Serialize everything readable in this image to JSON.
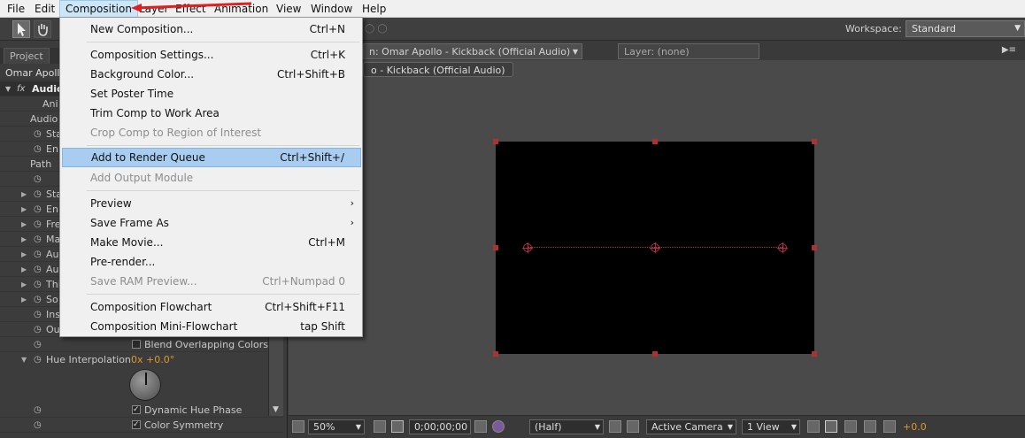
{
  "menubar": {
    "items": [
      "File",
      "Edit",
      "Composition",
      "Layer",
      "Effect",
      "Animation",
      "View",
      "Window",
      "Help"
    ]
  },
  "toolbar": {
    "workspace_label": "Workspace:",
    "workspace_value": "Standard"
  },
  "left_panel": {
    "tab_project": "Project",
    "comp_name": "Omar Apollo",
    "effect_name": "Audio",
    "rows": {
      "anim": "Ani",
      "audio": "Audio",
      "start": "Sta",
      "end": "En",
      "path": "Path",
      "sta2": "Sta",
      "end2": "En",
      "freq": "Fre",
      "max": "Ma",
      "aud1": "Au",
      "aud2": "Au",
      "thick": "Thi",
      "soft": "So",
      "inside": "Ins",
      "outside": "Ou"
    },
    "blend_overlapping": "Blend Overlapping Colors",
    "hue_interpolation_label": "Hue Interpolation",
    "hue_interpolation_value": "0x +0.0°",
    "dynamic_hue_phase": "Dynamic Hue Phase",
    "color_symmetry": "Color Symmetry"
  },
  "viewer": {
    "comp_tab": "n: Omar Apollo - Kickback (Official Audio)",
    "layer_tab": "Layer: (none)",
    "breadcrumb": "o - Kickback (Official Audio)",
    "zoom": "50%",
    "timecode": "0;00;00;00",
    "resolution": "(Half)",
    "camera": "Active Camera",
    "views": "1 View",
    "exposure": "+0.0"
  },
  "composition_menu": {
    "items": [
      {
        "label": "New Composition...",
        "shortcut": "Ctrl+N"
      },
      {
        "label": "Composition Settings...",
        "shortcut": "Ctrl+K"
      },
      {
        "label": "Background Color...",
        "shortcut": "Ctrl+Shift+B"
      },
      {
        "label": "Set Poster Time",
        "shortcut": ""
      },
      {
        "label": "Trim Comp to Work Area",
        "shortcut": ""
      },
      {
        "label": "Crop Comp to Region of Interest",
        "shortcut": ""
      },
      {
        "label": "Add to Render Queue",
        "shortcut": "Ctrl+Shift+/"
      },
      {
        "label": "Add Output Module",
        "shortcut": ""
      },
      {
        "label": "Preview",
        "shortcut": ""
      },
      {
        "label": "Save Frame As",
        "shortcut": ""
      },
      {
        "label": "Make Movie...",
        "shortcut": "Ctrl+M"
      },
      {
        "label": "Pre-render...",
        "shortcut": ""
      },
      {
        "label": "Save RAM Preview...",
        "shortcut": "Ctrl+Numpad 0"
      },
      {
        "label": "Composition Flowchart",
        "shortcut": "Ctrl+Shift+F11"
      },
      {
        "label": "Composition Mini-Flowchart",
        "shortcut": "tap Shift"
      }
    ]
  },
  "colors": {
    "accent_highlight": "#a8cdf0",
    "annotation_arrow": "#e02020",
    "handle_red": "#b03030",
    "value_orange": "#d99a2b"
  }
}
